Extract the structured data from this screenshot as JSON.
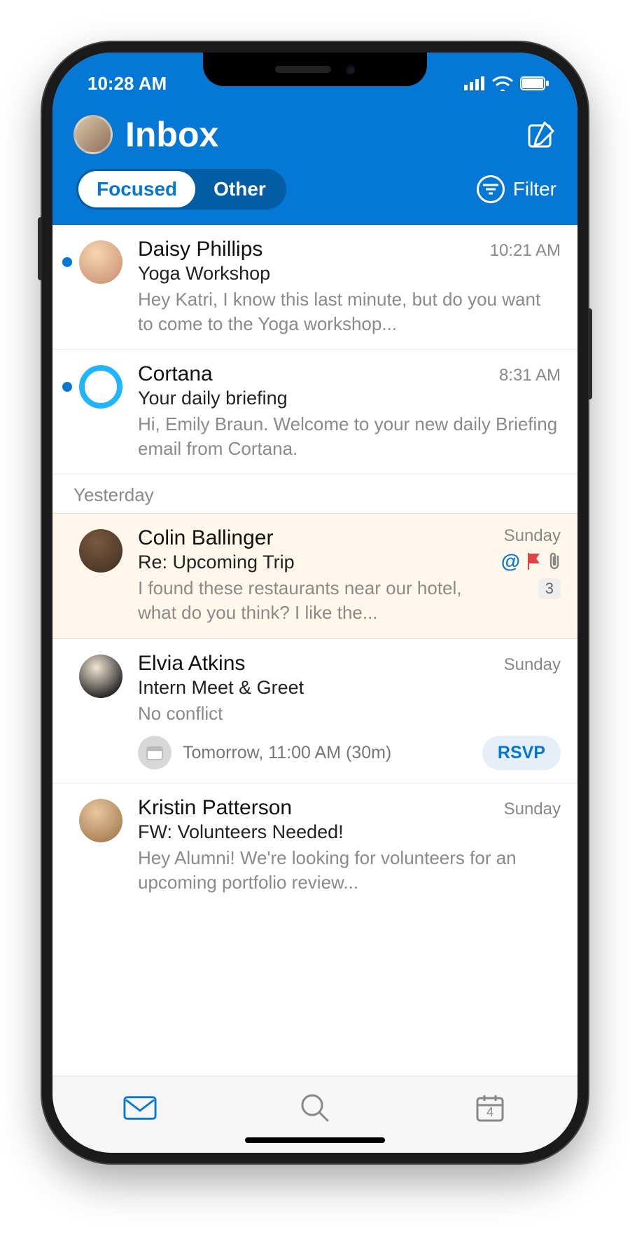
{
  "statusBar": {
    "time": "10:28 AM"
  },
  "header": {
    "title": "Inbox",
    "tabs": {
      "focused": "Focused",
      "other": "Other"
    },
    "filter": "Filter"
  },
  "sections": {
    "yesterday": "Yesterday"
  },
  "emails": [
    {
      "sender": "Daisy Phillips",
      "time": "10:21 AM",
      "subject": "Yoga Workshop",
      "preview": "Hey Katri, I know this last minute, but do you want to come to the Yoga workshop..."
    },
    {
      "sender": "Cortana",
      "time": "8:31 AM",
      "subject": "Your daily briefing",
      "preview": "Hi, Emily Braun. Welcome to your new daily Briefing email from Cortana."
    },
    {
      "sender": "Colin Ballinger",
      "time": "Sunday",
      "subject": "Re: Upcoming Trip",
      "preview": "I found these restaurants near our hotel, what do you think? I like the...",
      "count": "3"
    },
    {
      "sender": "Elvia Atkins",
      "time": "Sunday",
      "subject": "Intern Meet & Greet",
      "preview": "No conflict",
      "event": "Tomorrow, 11:00 AM (30m)",
      "rsvp": "RSVP"
    },
    {
      "sender": "Kristin Patterson",
      "time": "Sunday",
      "subject": "FW: Volunteers Needed!",
      "preview": "Hey Alumni! We're looking for volunteers for an upcoming portfolio review..."
    }
  ],
  "tabBar": {
    "calendarDay": "4"
  }
}
